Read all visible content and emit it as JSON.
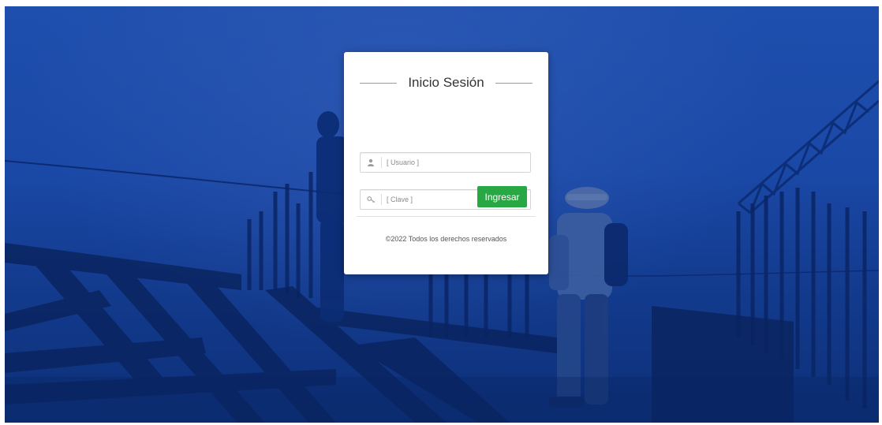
{
  "login": {
    "title": "Inicio Sesión",
    "username": {
      "placeholder": "[ Usuario ]",
      "value": "",
      "icon": "user-icon"
    },
    "password": {
      "placeholder": "[ Clave ]",
      "value": "",
      "icon": "key-icon"
    },
    "submit_label": "Ingresar",
    "footer": "©2022 Todos los derechos reservados"
  },
  "colors": {
    "background_blue": "#1a48a6",
    "button_green": "#28a745",
    "card_white": "#ffffff"
  }
}
